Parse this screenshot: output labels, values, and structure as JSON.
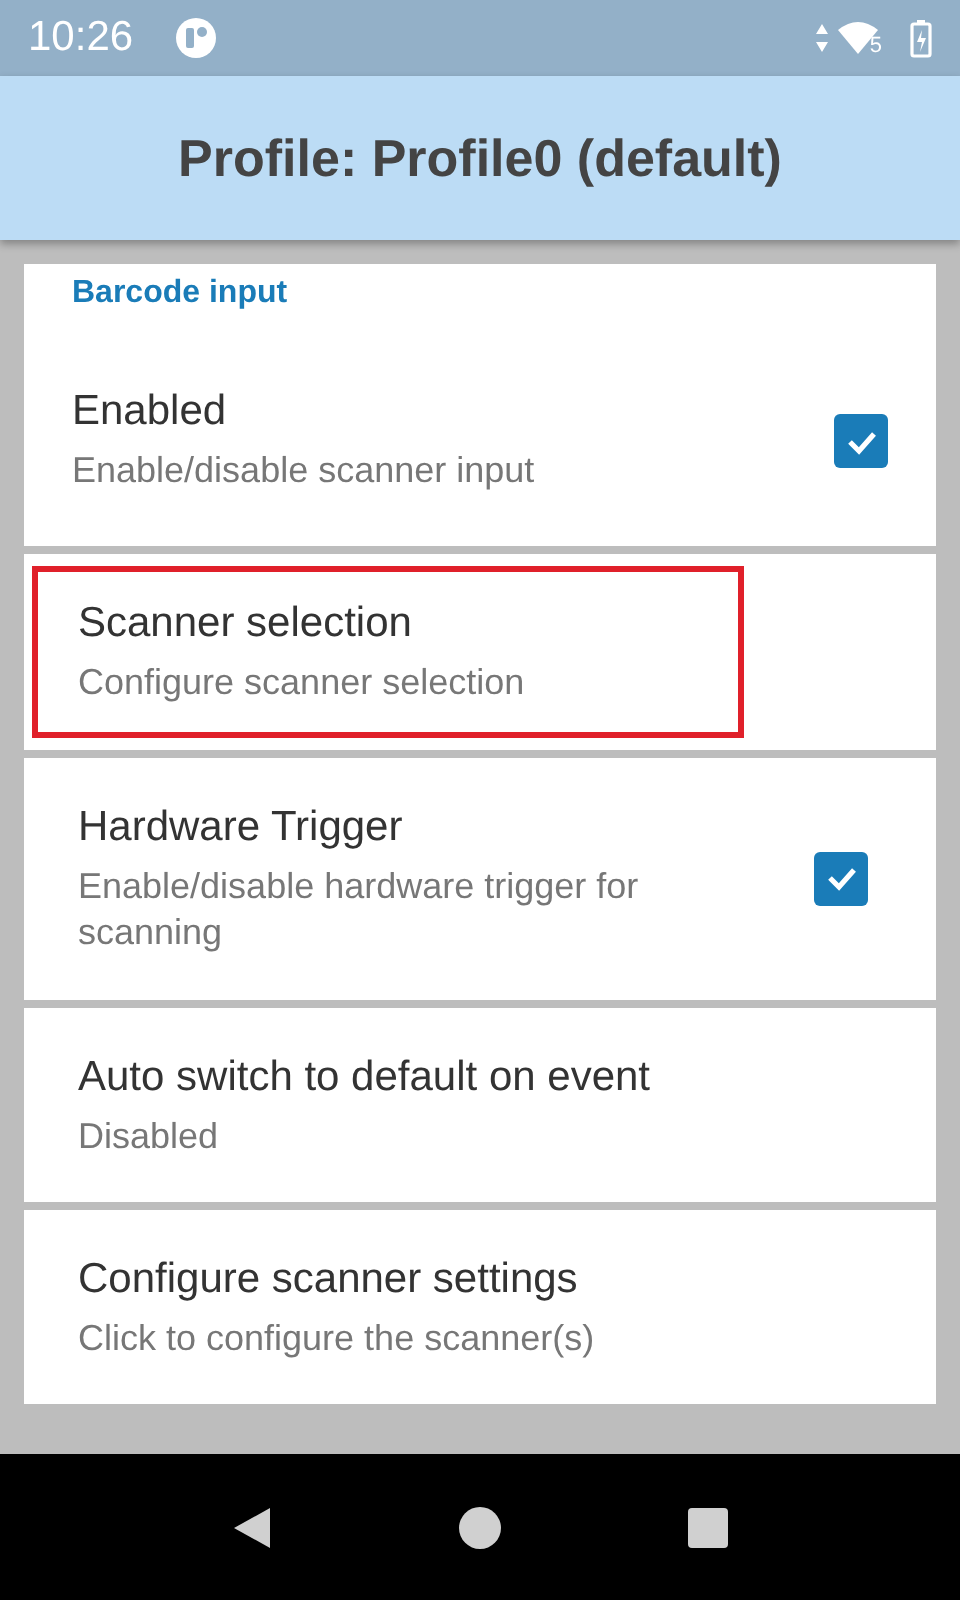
{
  "status_bar": {
    "time": "10:26",
    "wifi_badge": "5"
  },
  "app_bar": {
    "title": "Profile: Profile0 (default)"
  },
  "section": {
    "title": "Barcode input"
  },
  "settings": [
    {
      "kind": "checkbox",
      "title": "Enabled",
      "summary": "Enable/disable scanner input",
      "checked": true
    },
    {
      "kind": "plain",
      "title": "Scanner selection",
      "summary": "Configure scanner selection",
      "highlighted": true
    },
    {
      "kind": "checkbox",
      "title": "Hardware Trigger",
      "summary": "Enable/disable hardware trigger for scanning",
      "checked": true,
      "highlighted": false
    },
    {
      "kind": "plain",
      "title": "Auto switch to default on event",
      "summary": "Disabled",
      "highlighted": false
    },
    {
      "kind": "plain",
      "title": "Configure scanner settings",
      "summary": "Click to configure the scanner(s)",
      "highlighted": false
    }
  ]
}
